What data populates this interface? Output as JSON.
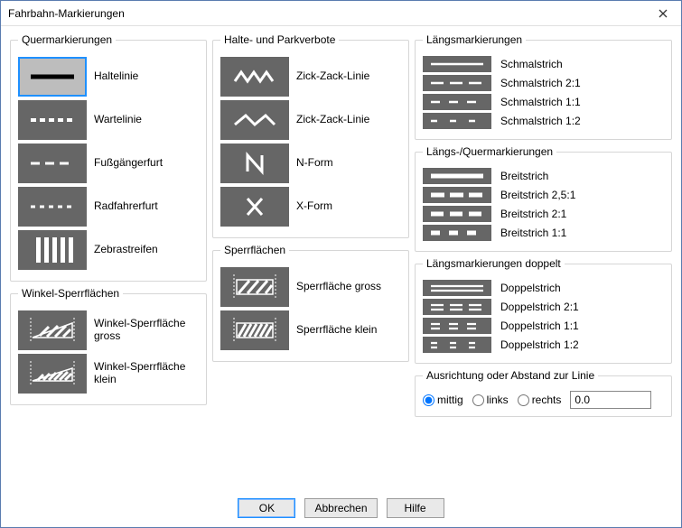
{
  "window": {
    "title": "Fahrbahn-Markierungen"
  },
  "groups": {
    "quer": {
      "legend": "Quermarkierungen",
      "items": [
        "Haltelinie",
        "Wartelinie",
        "Fußgängerfurt",
        "Radfahrerfurt",
        "Zebrastreifen"
      ]
    },
    "winkel": {
      "legend": "Winkel-Sperrflächen",
      "items": [
        "Winkel-Sperrfläche gross",
        "Winkel-Sperrfläche klein"
      ]
    },
    "halte": {
      "legend": "Halte- und Parkverbote",
      "items": [
        "Zick-Zack-Linie",
        "Zick-Zack-Linie",
        "N-Form",
        "X-Form"
      ]
    },
    "sperr": {
      "legend": "Sperrflächen",
      "items": [
        "Sperrfläche gross",
        "Sperrfläche klein"
      ]
    },
    "laengs": {
      "legend": "Längsmarkierungen",
      "items": [
        "Schmalstrich",
        "Schmalstrich 2:1",
        "Schmalstrich 1:1",
        "Schmalstrich 1:2"
      ]
    },
    "laengsquer": {
      "legend": "Längs-/Quermarkierungen",
      "items": [
        "Breitstrich",
        "Breitstrich 2,5:1",
        "Breitstrich 2:1",
        "Breitstrich 1:1"
      ]
    },
    "doppelt": {
      "legend": "Längsmarkierungen doppelt",
      "items": [
        "Doppelstrich",
        "Doppelstrich 2:1",
        "Doppelstrich 1:1",
        "Doppelstrich 1:2"
      ]
    },
    "ausrichtung": {
      "legend": "Ausrichtung oder Abstand zur Linie",
      "radios": [
        "mittig",
        "links",
        "rechts"
      ],
      "selected": "mittig",
      "value": "0.0"
    }
  },
  "buttons": {
    "ok": "OK",
    "cancel": "Abbrechen",
    "help": "Hilfe"
  }
}
